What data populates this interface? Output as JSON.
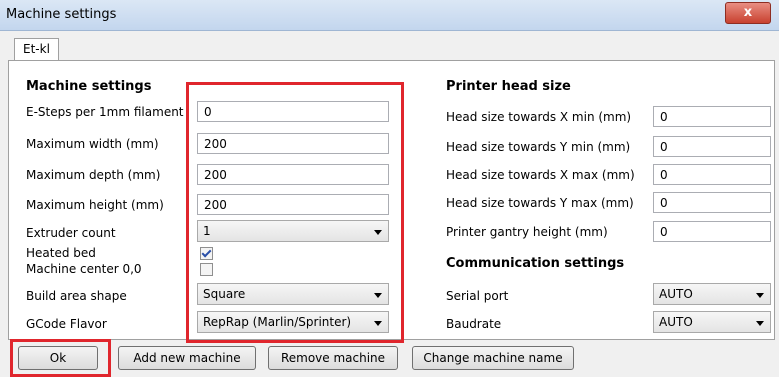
{
  "window": {
    "title": "Machine settings",
    "close_glyph": "x"
  },
  "tab": {
    "label": "Et-kl"
  },
  "machine": {
    "heading": "Machine settings",
    "rows": [
      {
        "label": "E-Steps per 1mm filament",
        "value": "0"
      },
      {
        "label": "Maximum width (mm)",
        "value": "200"
      },
      {
        "label": "Maximum depth (mm)",
        "value": "200"
      },
      {
        "label": "Maximum height (mm)",
        "value": "200"
      }
    ],
    "extruder": {
      "label": "Extruder count",
      "value": "1"
    },
    "heated_bed": {
      "label": "Heated bed",
      "checked": true
    },
    "center": {
      "label": "Machine center 0,0",
      "checked": false
    },
    "shape": {
      "label": "Build area shape",
      "value": "Square"
    },
    "gcode": {
      "label": "GCode Flavor",
      "value": "RepRap (Marlin/Sprinter)"
    }
  },
  "head": {
    "heading": "Printer head size",
    "rows": [
      {
        "label": "Head size towards X min (mm)",
        "value": "0"
      },
      {
        "label": "Head size towards Y min (mm)",
        "value": "0"
      },
      {
        "label": "Head size towards X max (mm)",
        "value": "0"
      },
      {
        "label": "Head size towards Y max (mm)",
        "value": "0"
      },
      {
        "label": "Printer gantry height (mm)",
        "value": "0"
      }
    ]
  },
  "comm": {
    "heading": "Communication settings",
    "serial": {
      "label": "Serial port",
      "value": "AUTO"
    },
    "baud": {
      "label": "Baudrate",
      "value": "AUTO"
    }
  },
  "buttons": {
    "ok": "Ok",
    "add": "Add new machine",
    "remove": "Remove machine",
    "rename": "Change machine name"
  },
  "colors": {
    "highlight": "#e0262d"
  }
}
